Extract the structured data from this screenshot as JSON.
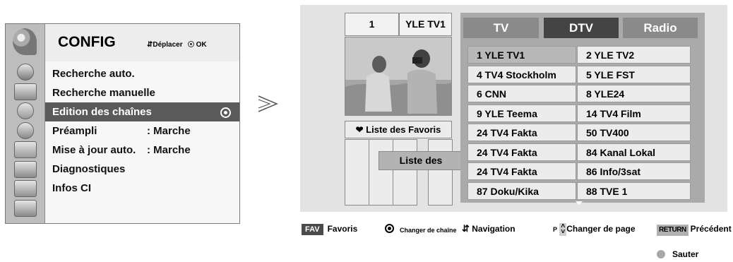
{
  "config": {
    "title": "CONFIG",
    "hint_move": "Déplacer",
    "hint_ok": "OK",
    "items": [
      {
        "label": "Recherche auto.",
        "value": ""
      },
      {
        "label": "Recherche manuelle",
        "value": ""
      },
      {
        "label": "Edition des chaînes",
        "value": ""
      },
      {
        "label": "Préampli",
        "value": ": Marche"
      },
      {
        "label": "Mise à jour auto.",
        "value": ": Marche"
      },
      {
        "label": "Diagnostiques",
        "value": ""
      },
      {
        "label": "Infos CI",
        "value": ""
      }
    ],
    "selected_index": 2,
    "side_icons": [
      "satellite-dish-icon",
      "globe-icon",
      "tv-icon",
      "speaker-icon",
      "clock-icon",
      "calendar-icon",
      "lock-icon",
      "input-plug-icon",
      "photo-icon"
    ]
  },
  "editor": {
    "channel_number": "1",
    "channel_name": "YLE TV1",
    "tabs": [
      "TV",
      "DTV",
      "Radio"
    ],
    "active_tab": "DTV",
    "fav_list_label": "Liste des Favoris",
    "fav_popup": "Liste des",
    "channels": [
      [
        "1 YLE TV1",
        "2 YLE TV2"
      ],
      [
        "4 TV4 Stockholm",
        "5 YLE FST"
      ],
      [
        "6 CNN",
        "8 YLE24"
      ],
      [
        "9 YLE Teema",
        "14 TV4 Film"
      ],
      [
        "24 TV4 Fakta",
        "50 TV400"
      ],
      [
        "24 TV4 Fakta",
        "84 Kanal Lokal"
      ],
      [
        "24 TV4 Fakta",
        "86 Info/3sat"
      ],
      [
        "87 Doku/Kika",
        "88 TVE 1"
      ]
    ],
    "highlighted": "1 YLE TV1"
  },
  "help": {
    "fav_key": "FAV",
    "fav_text": "Favoris",
    "change_channel": "Changer de chaîne",
    "navigation": "Navigation",
    "p_key": "P",
    "change_page": "Changer de page",
    "return_key": "RETURN",
    "previous": "Précédent",
    "skip": "Sauter"
  },
  "colors": {
    "selected_row": "#5a5a5a",
    "active_tab": "#444444",
    "inactive_tab": "#8a8a8a"
  }
}
